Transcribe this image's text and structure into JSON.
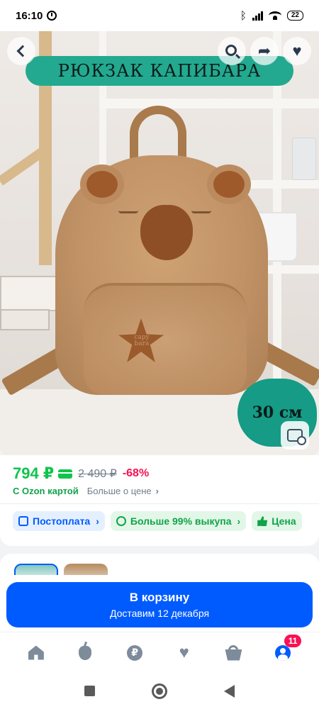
{
  "status_bar": {
    "time": "16:10",
    "battery": "22"
  },
  "product": {
    "banner_title": "РЮКЗАК КАПИБАРА",
    "size_badge": "30 см",
    "star_patch_text": "capy bara"
  },
  "top_actions": {
    "back": "back-icon",
    "search": "search-icon",
    "share": "share-icon",
    "favorite": "heart-icon"
  },
  "price": {
    "current": "794 ₽",
    "old": "2 490 ₽",
    "discount": "-68%",
    "card_label": "С Ozon картой",
    "more_label": "Больше о цене",
    "more_chevron": "›"
  },
  "chips": [
    {
      "label": "Постоплата",
      "chevron": "›"
    },
    {
      "label": "Больше 99% выкупа",
      "chevron": "›"
    },
    {
      "label": "Цена"
    }
  ],
  "cart": {
    "title": "В корзину",
    "subtitle": "Доставим 12 декабря"
  },
  "bottom_nav": {
    "items": [
      "home-icon",
      "apple-icon",
      "ruble-icon",
      "heart-icon",
      "basket-icon",
      "profile-icon"
    ],
    "ruble_glyph": "₽",
    "profile_badge": "11"
  },
  "colors": {
    "accent_blue": "#005bff",
    "price_green": "#10c44c",
    "discount_red": "#f91155",
    "banner_teal": "#23a98f"
  }
}
